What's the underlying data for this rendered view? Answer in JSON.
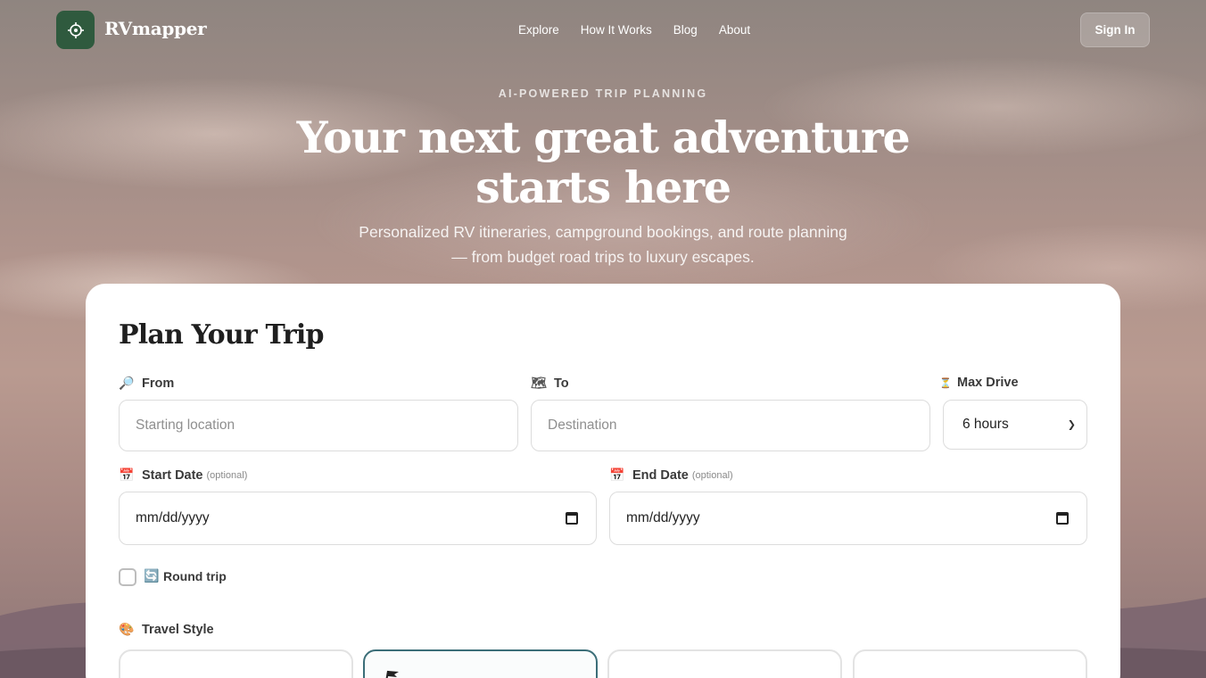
{
  "header": {
    "brand": "RVmapper",
    "nav": [
      "Explore",
      "How It Works",
      "Blog",
      "About"
    ],
    "sign_in": "Sign In"
  },
  "hero": {
    "eyebrow": "AI-POWERED TRIP PLANNING",
    "title": "Your next great adventure starts here",
    "subtitle": "Personalized RV itineraries, campground bookings, and route planning — from budget road trips to luxury escapes."
  },
  "planner": {
    "title": "Plan Your Trip",
    "from": {
      "label": "From",
      "icon": "🔎",
      "placeholder": "Starting location"
    },
    "to": {
      "label": "To",
      "icon": "🗺",
      "placeholder": "Destination"
    },
    "max_drive": {
      "label": "Max Drive",
      "icon": "⏳",
      "value": "6 hours"
    },
    "start_date": {
      "label": "Start Date",
      "optional": "(optional)",
      "icon": "📅",
      "value": "mm/dd/yyyy"
    },
    "end_date": {
      "label": "End Date",
      "optional": "(optional)",
      "icon": "📅",
      "value": "mm/dd/yyyy"
    },
    "round_trip": {
      "label": "Round trip",
      "icon": "🔄",
      "checked": false
    },
    "travel_style": {
      "label": "Travel Style",
      "icon": "🎨"
    }
  },
  "colors": {
    "logo_bg": "#2f5a3e",
    "active_border": "#3b6e78"
  }
}
